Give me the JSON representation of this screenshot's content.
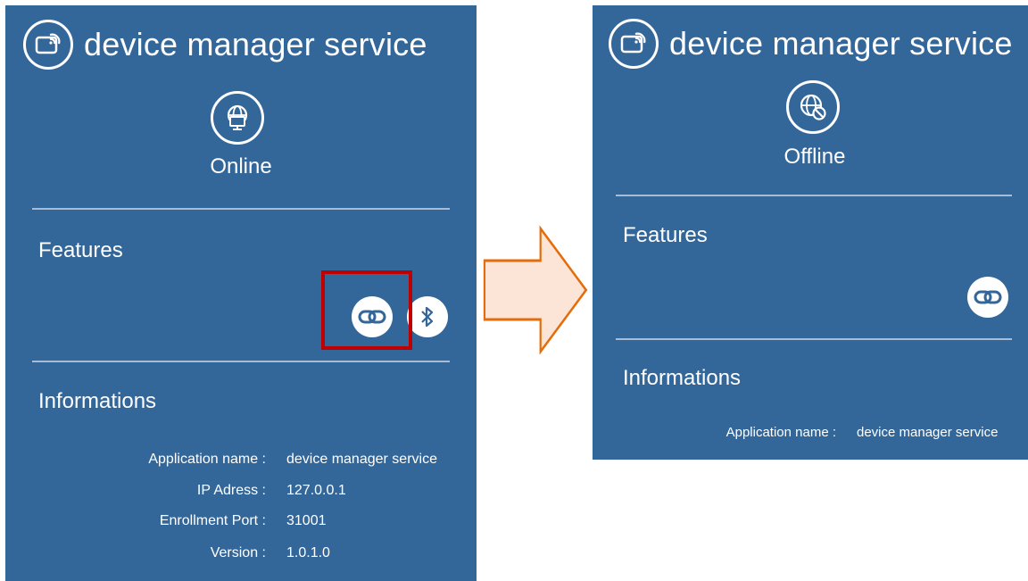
{
  "before": {
    "header_title": "device manager service",
    "status": "Online",
    "features_title": "Features",
    "informations_title": "Informations",
    "info": [
      {
        "label": "Application name :",
        "value": "device manager service"
      },
      {
        "label": "IP Adress :",
        "value": "127.0.0.1"
      },
      {
        "label": "Enrollment Port :",
        "value": "31001"
      },
      {
        "label": "Version :",
        "value": "1.0.1.0"
      }
    ]
  },
  "after": {
    "header_title": "device manager service",
    "status": "Offline",
    "features_title": "Features",
    "informations_title": "Informations",
    "info": [
      {
        "label": "Application name :",
        "value": "device manager service"
      }
    ]
  },
  "icons": {
    "logo": "device-cast-icon",
    "online": "globe-monitor-icon",
    "offline": "globe-blocked-icon",
    "link": "link-icon",
    "bluetooth": "bluetooth-icon",
    "arrow": "right-arrow-icon"
  },
  "colors": {
    "panel_background": "#336699",
    "divider": "#a7bcd6",
    "highlight_border": "#c00000",
    "arrow_fill": "#fce4d6",
    "arrow_stroke": "#e46c0a"
  }
}
